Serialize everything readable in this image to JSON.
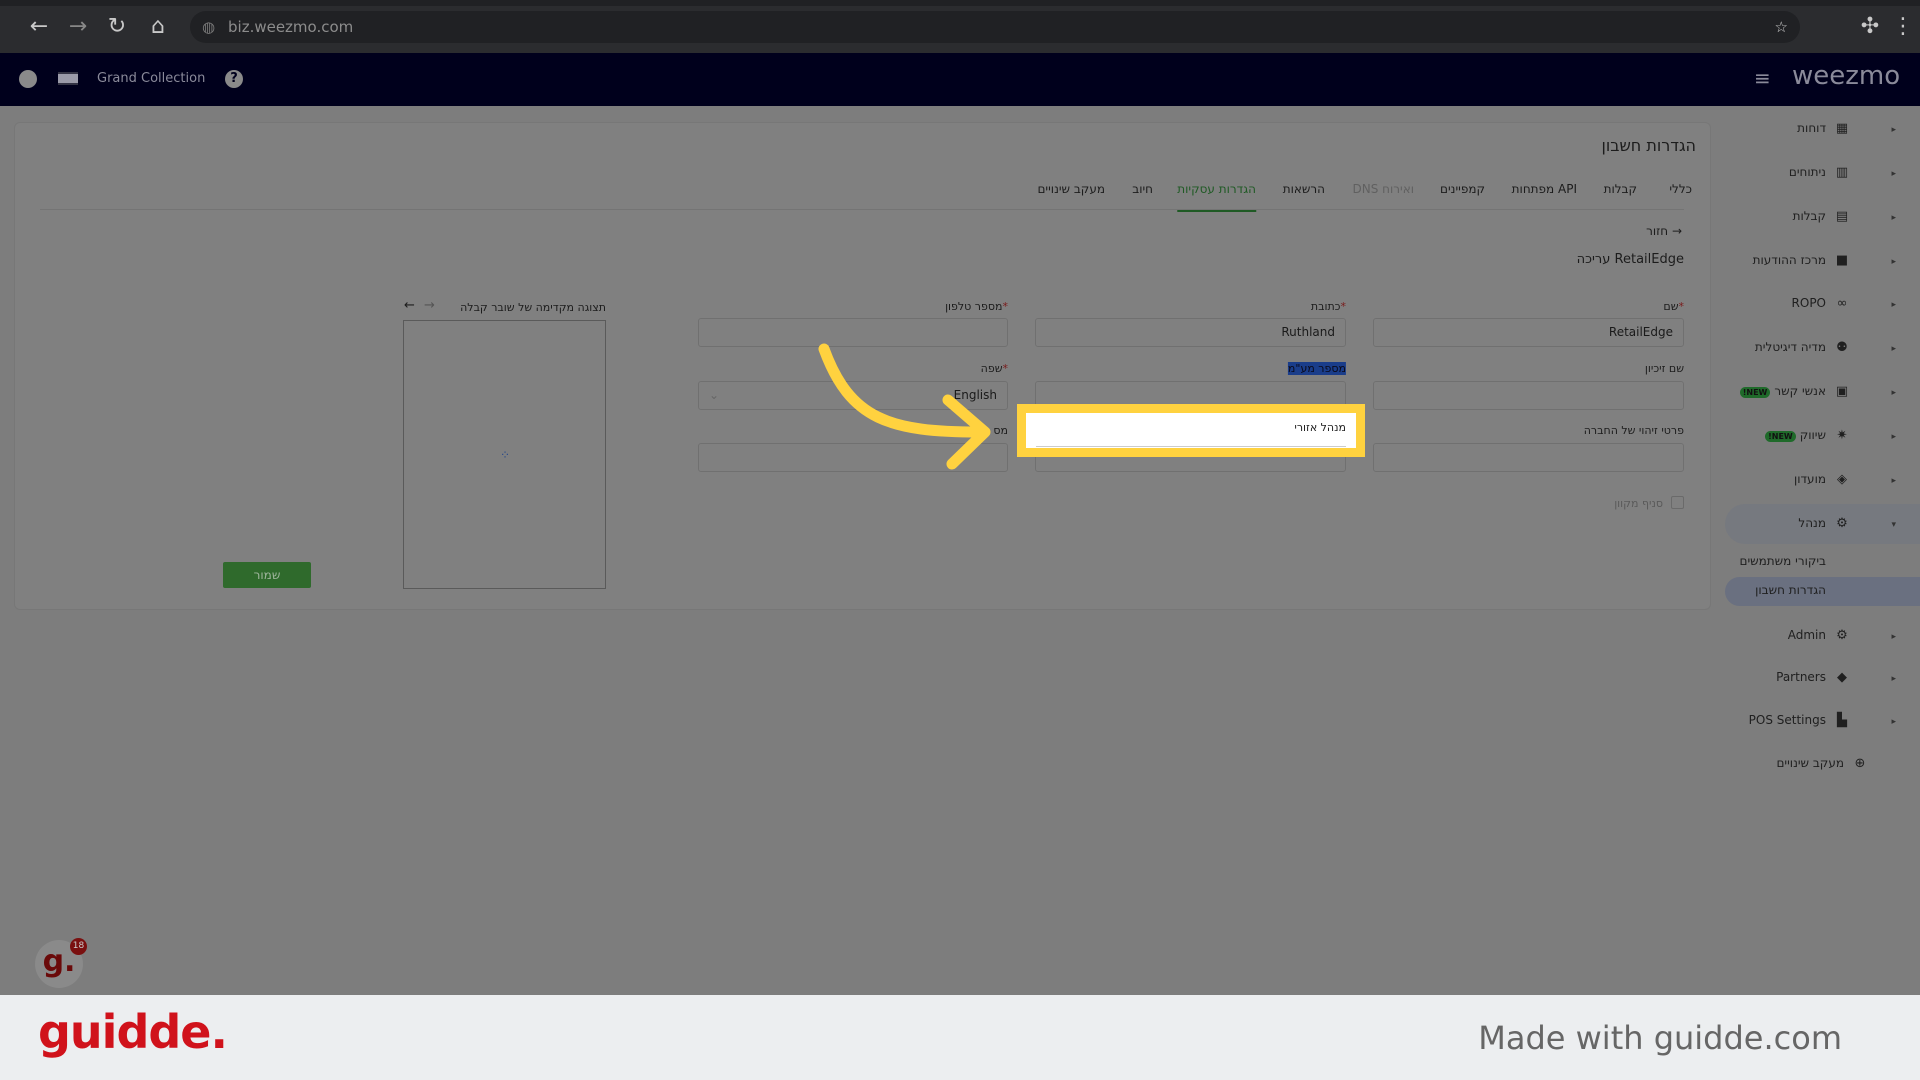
{
  "browser": {
    "url": "biz.weezmo.com"
  },
  "header": {
    "store_name": "Grand Collection",
    "brand": "weezmo"
  },
  "page": {
    "title": "הגדרות חשבון",
    "back": "חזור",
    "edit_heading": "עריכה RetailEdge"
  },
  "tabs": [
    {
      "label": "כללי"
    },
    {
      "label": "קבלות"
    },
    {
      "label": "מפתחות API"
    },
    {
      "label": "קמפיינים"
    },
    {
      "label": "DNS ואירוח",
      "disabled": true
    },
    {
      "label": "הרשאות"
    },
    {
      "label": "הגדרות עסקיות",
      "active": true
    },
    {
      "label": "חיוב"
    },
    {
      "label": "מעקב שינויים"
    }
  ],
  "form": {
    "name_label": "שם",
    "name_value": "RetailEdge",
    "address_label": "כתובת",
    "address_value": "Ruthland",
    "phone_label": "מספר טלפון",
    "phone_value": "",
    "franchise_label": "שם זיכיון",
    "vat_label": "מספר מע\"מ",
    "language_label": "שפה",
    "language_value": "English",
    "company_id_label": "פרטי זיהוי של החברה",
    "regional_manager_label": "מנהל אזורי",
    "third_label_partial": "מס",
    "local_branch_label": "סניף מקוון",
    "save": "שמור"
  },
  "preview": {
    "label": "תצוגה מקדימה של שובר קבלה"
  },
  "sidebar": {
    "items": [
      {
        "label": "דוחות",
        "icon": "dashboard-icon"
      },
      {
        "label": "ניתוחים",
        "icon": "analytics-icon"
      },
      {
        "label": "קבלות",
        "icon": "receipt-icon"
      },
      {
        "label": "מרכז ההודעות",
        "icon": "message-icon"
      },
      {
        "label": "ROPO",
        "icon": "infinity-icon"
      },
      {
        "label": "מדיה דיגיטלית",
        "icon": "people-icon"
      },
      {
        "label": "אנשי קשר",
        "icon": "contact-icon",
        "badge": "NEW!"
      },
      {
        "label": "שיווק",
        "icon": "party-icon",
        "badge": "NEW!"
      },
      {
        "label": "מועדון",
        "icon": "tag-icon"
      },
      {
        "label": "מנהל",
        "icon": "gear-icon",
        "expanded": true
      },
      {
        "label": "ביקורי משתמשים"
      },
      {
        "label": "הגדרות חשבון",
        "active": true
      },
      {
        "label": "Admin",
        "icon": "admin-gear-icon"
      },
      {
        "label": "Partners",
        "icon": "handshake-icon"
      },
      {
        "label": "POS Settings",
        "icon": "register-icon"
      },
      {
        "label": "מעקב שינויים",
        "icon": "zoom-icon"
      }
    ]
  },
  "guidde": {
    "logo": "guidde.",
    "made_with": "Made with guidde.com",
    "badge_count": "18"
  },
  "colors": {
    "highlight": "#ffd23f",
    "accent_green": "#2f7a35",
    "header_navy": "#00001c"
  }
}
